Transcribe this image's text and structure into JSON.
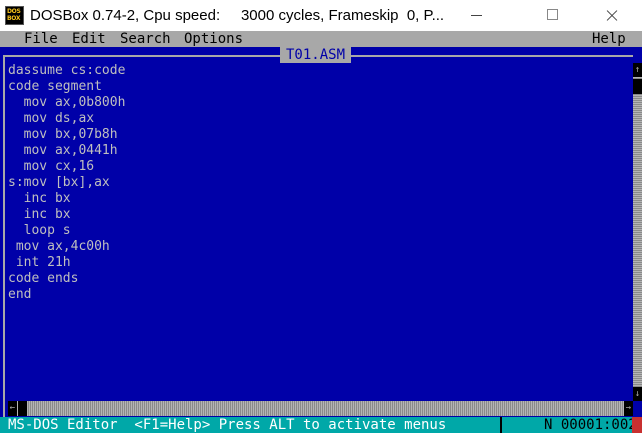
{
  "window": {
    "title": "DOSBox 0.74-2, Cpu speed:     3000 cycles, Frameskip  0, P...",
    "icon_top": "DOS",
    "icon_bottom": "BOX"
  },
  "menubar": {
    "file": "File",
    "edit": "Edit",
    "search": "Search",
    "options": "Options",
    "help": "Help"
  },
  "editor": {
    "file_title": "T01.ASM",
    "code": "dassume cs:code\ncode segment\n  mov ax,0b800h\n  mov ds,ax\n  mov bx,07b8h\n  mov ax,0441h\n  mov cx,16\ns:mov [bx],ax\n  inc bx\n  inc bx\n  loop s\n mov ax,4c00h\n int 21h\ncode ends\nend"
  },
  "scroll": {
    "up": "↑",
    "down": "↓",
    "left": "←",
    "right": "→"
  },
  "statusbar": {
    "left": "MS-DOS Editor  <F1=Help> Press ALT to activate menus",
    "right": "N 00001:002"
  },
  "colors": {
    "dos_blue": "#0000a8",
    "menu_gray": "#a8a8a8",
    "status_cyan": "#00a8a8",
    "text_gray": "#bfbfbf"
  }
}
